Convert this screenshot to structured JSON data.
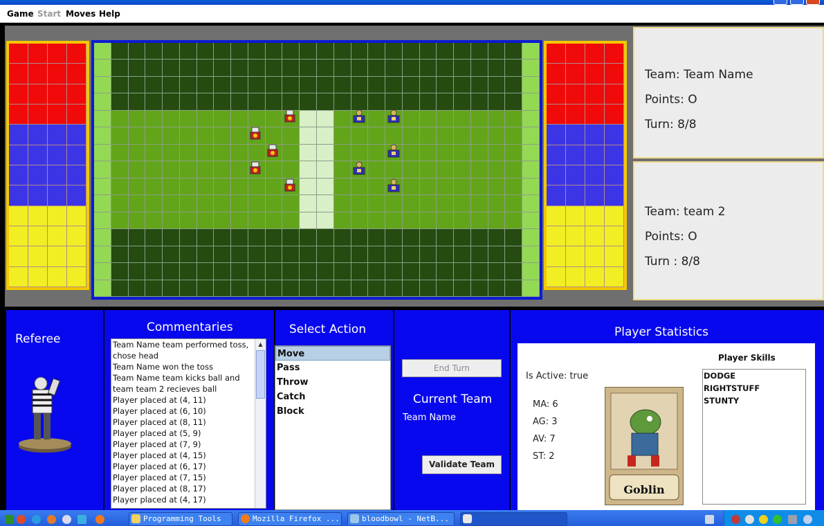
{
  "menu": {
    "items": [
      {
        "label": "Game",
        "enabled": true
      },
      {
        "label": "Start",
        "enabled": false
      },
      {
        "label": "Moves",
        "enabled": true
      },
      {
        "label": "Help",
        "enabled": true
      }
    ]
  },
  "teams": [
    {
      "team_label": "Team: Team Name",
      "points_label": "Points: O",
      "turn_label": "Turn: 8/8"
    },
    {
      "team_label": "Team: team 2",
      "points_label": "Points: O",
      "turn_label": "Turn : 8/8"
    }
  ],
  "referee": {
    "title": "Referee"
  },
  "commentary": {
    "title": "Commentaries",
    "lines": [
      "Team Name team performed toss,",
      "chose head",
      "Team Name won the toss",
      "Team Name team kicks ball and",
      "team team 2 recieves ball",
      "Player placed at (4, 11)",
      "Player placed at (6, 10)",
      "Player placed at (8, 11)",
      "Player placed at (5, 9)",
      "Player placed at (7, 9)",
      "Player placed at (4, 15)",
      "Player placed at (6, 17)",
      "Player placed at (7, 15)",
      "Player placed at (8, 17)",
      "Player placed at (4, 17)"
    ]
  },
  "actions": {
    "title": "Select Action",
    "items": [
      "Move",
      "Pass",
      "Throw",
      "Catch",
      "Block"
    ],
    "selected": "Move"
  },
  "turn_controls": {
    "end_turn_label": "End Turn",
    "current_team_title": "Current Team",
    "current_team_value": "Team Name",
    "validate_label": "Validate Team"
  },
  "stats": {
    "title": "Player Statistics",
    "is_active": "Is Active: true",
    "ma": "MA: 6",
    "ag": "AG: 3",
    "av": "AV: 7",
    "st": "ST: 2",
    "card_name": "Goblin",
    "skills_title": "Player Skills",
    "skills": [
      "DODGE",
      "RIGHTSTUFF",
      "STUNTY"
    ]
  },
  "taskbar": {
    "tasks": [
      "Programming Tools",
      "Mozilla Firefox ...",
      "bloodbowl - NetB..."
    ]
  },
  "colors": {
    "team1_red": "#f00a0a",
    "team2_blue": "#3c35e6",
    "dugout_yellow": "#f1ee24",
    "pitch_dark": "#254b10",
    "pitch_field": "#63a51a",
    "panel_blue": "#0808ee"
  }
}
